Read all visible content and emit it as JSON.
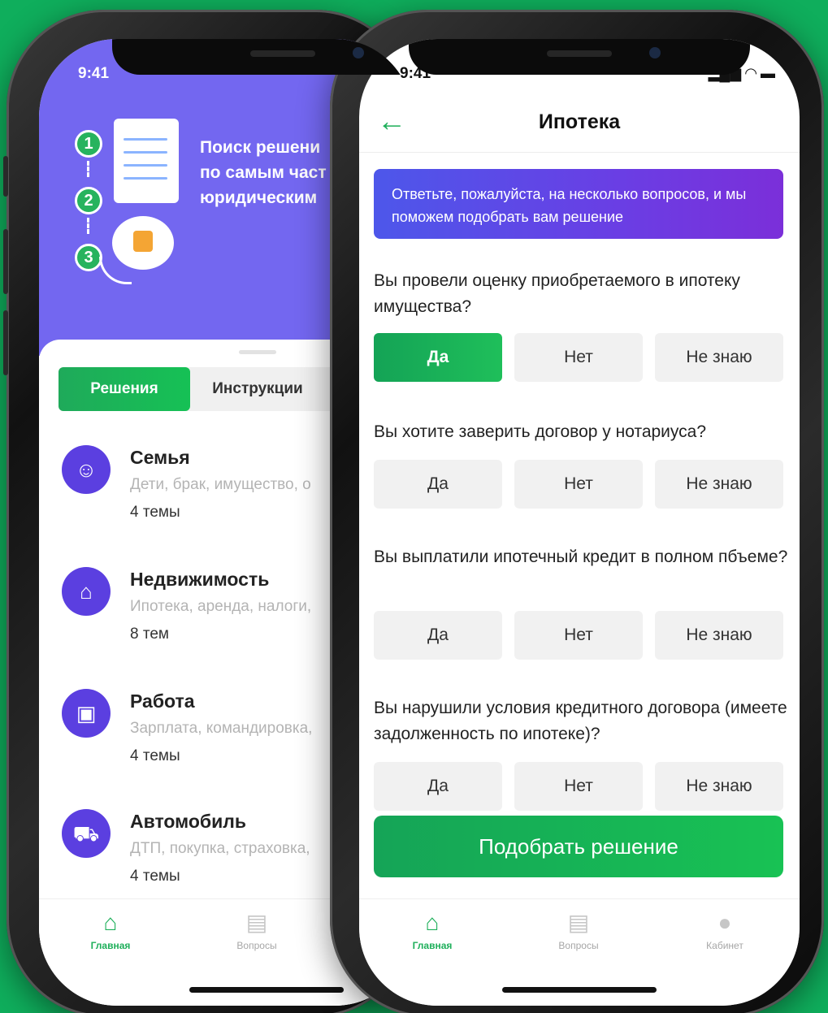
{
  "left_phone": {
    "status_time": "9:41",
    "hero": {
      "steps": [
        "1",
        "2",
        "3"
      ],
      "title": "Поиск решени\nпо самым част\nюридическим"
    },
    "segment": {
      "tabs": [
        "Решения",
        "Инструкции"
      ]
    },
    "categories": [
      {
        "icon": "family-icon",
        "title": "Семья",
        "desc": "Дети, брак, имущество, о",
        "count": "4 темы"
      },
      {
        "icon": "house-icon",
        "title": "Недвижимость",
        "desc": "Ипотека, аренда, налоги,",
        "count": "8 тем"
      },
      {
        "icon": "briefcase-icon",
        "title": "Работа",
        "desc": "Зарплата, командировка,",
        "count": "4 темы"
      },
      {
        "icon": "car-icon",
        "title": "Автомобиль",
        "desc": "ДТП, покупка, страховка,",
        "count": "4 темы"
      }
    ],
    "tabbar": [
      "Главная",
      "Вопросы"
    ]
  },
  "right_phone": {
    "status_time": "9:41",
    "nav_title": "Ипотека",
    "intro_text": "Ответьте, пожалуйста, на несколько вопросов, и мы поможем подобрать вам решение",
    "answer_labels": [
      "Да",
      "Нет",
      "Не знаю"
    ],
    "questions": [
      {
        "text": "Вы провели оценку приобретаемого в ипотеку имущества?",
        "selected": "Да"
      },
      {
        "text": "Вы хотите заверить договор у нотариуса?",
        "selected": null
      },
      {
        "text": "Вы выплатили ипотечный кредит в полном пбъеме?",
        "selected": null
      },
      {
        "text": "Вы нарушили условия кредитного договора (имеете задолженность по ипотеке)?",
        "selected": null
      }
    ],
    "submit_label": "Подобрать решение",
    "tabbar": [
      "Главная",
      "Вопросы",
      "Кабинет"
    ]
  },
  "colors": {
    "background": "#0fae5c",
    "accent_green": "#1eaf5a",
    "purple": "#7367f0",
    "icon_purple": "#5b3fe0"
  }
}
